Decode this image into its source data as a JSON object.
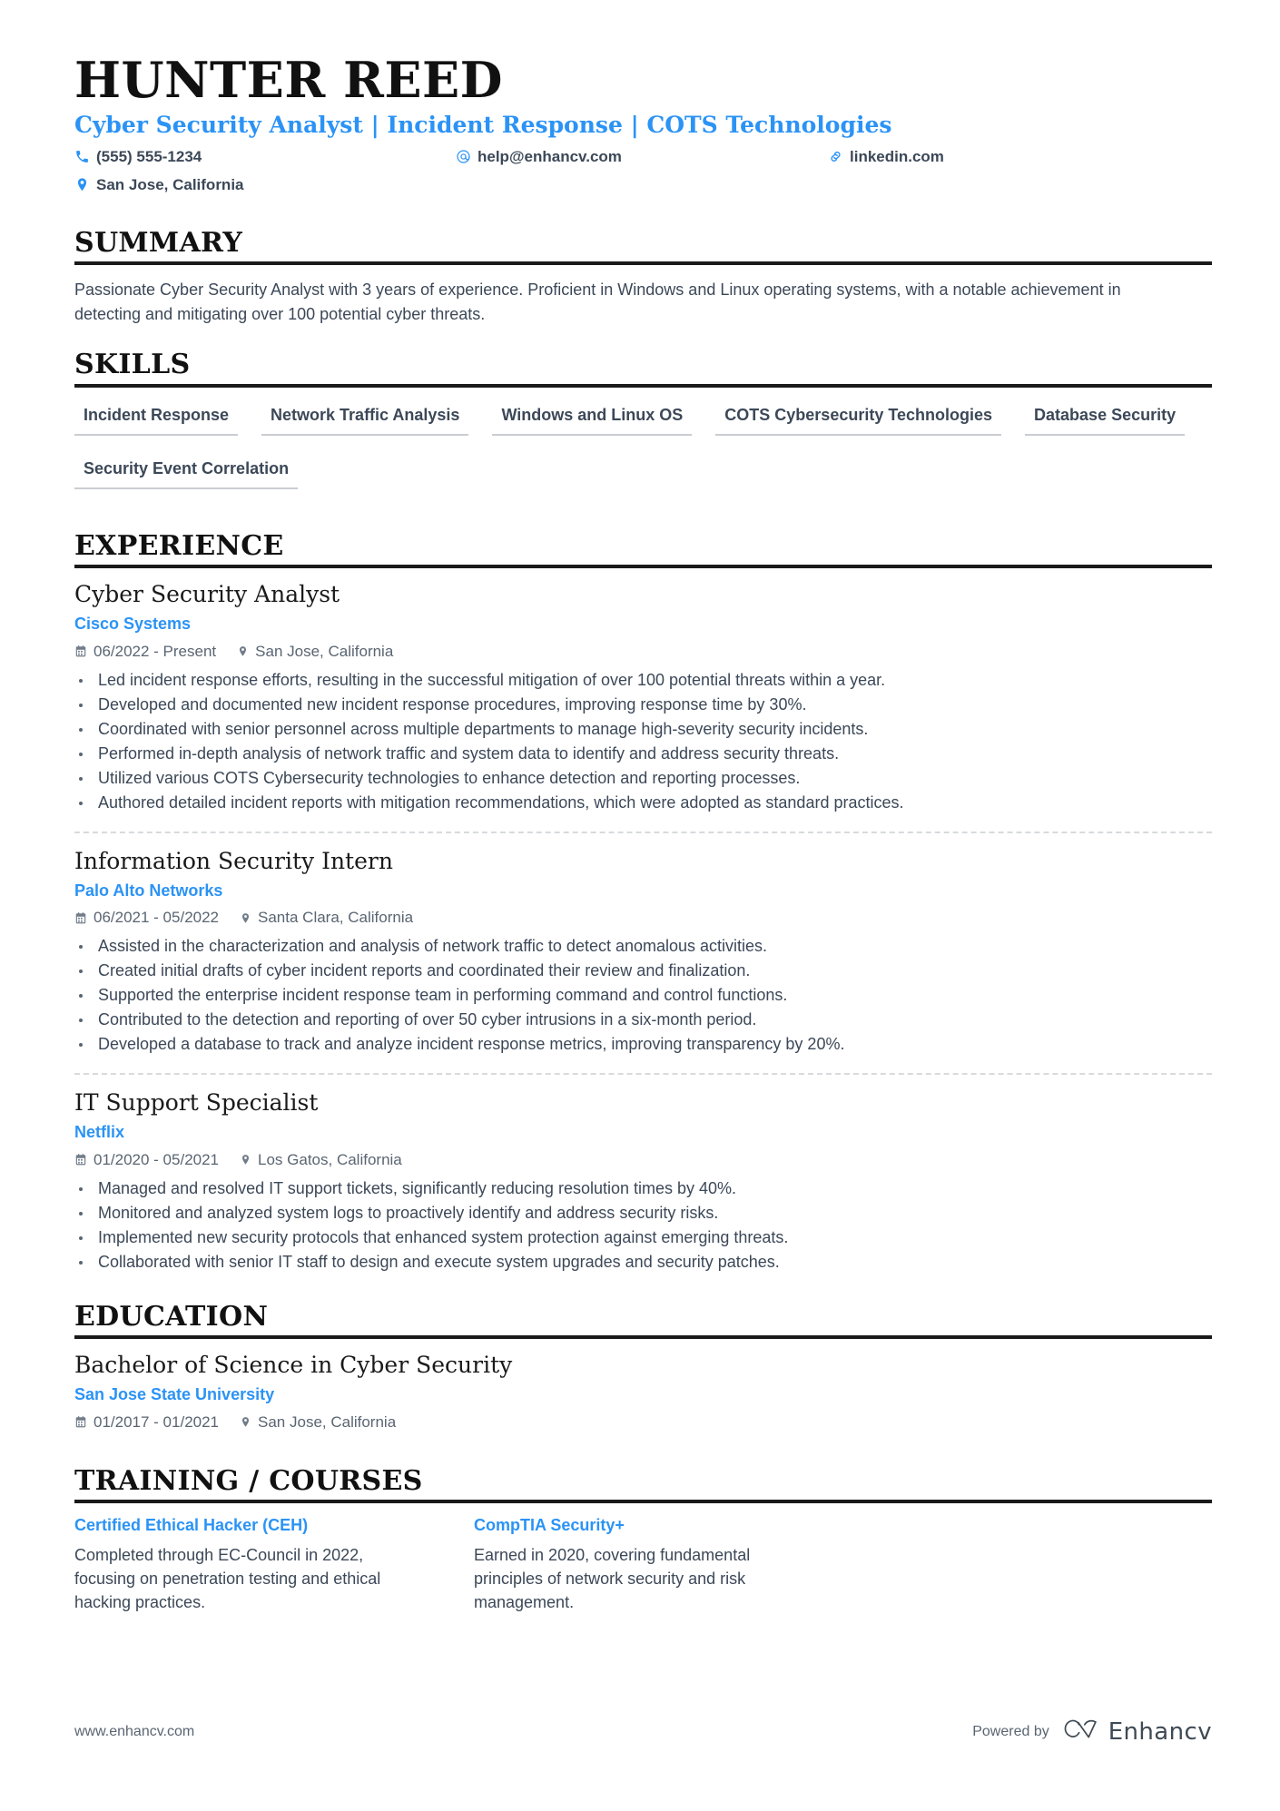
{
  "header": {
    "name": "HUNTER REED",
    "headline": "Cyber Security Analyst | Incident Response | COTS Technologies",
    "contacts": [
      {
        "icon": "phone-icon",
        "text": "(555) 555-1234"
      },
      {
        "icon": "email-icon",
        "text": "help@enhancv.com"
      },
      {
        "icon": "link-icon",
        "text": "linkedin.com"
      },
      {
        "icon": "location-pin-icon",
        "text": "San Jose, California"
      }
    ]
  },
  "colors": {
    "accent_blue": "#2b93f5",
    "text_dark": "#3c4858",
    "rule_black": "#1a1a1a",
    "skill_underline": "#c9ccd1",
    "divider_dashed": "#d8dadd"
  },
  "summary": {
    "title": "SUMMARY",
    "text": "Passionate Cyber Security Analyst with 3 years of experience. Proficient in Windows and Linux operating systems, with a notable achievement in detecting and mitigating over 100 potential cyber threats."
  },
  "skills": {
    "title": "SKILLS",
    "items": [
      "Incident Response",
      "Network Traffic Analysis",
      "Windows and Linux OS",
      "COTS Cybersecurity Technologies",
      "Database Security",
      "Security Event Correlation"
    ]
  },
  "experience": {
    "title": "EXPERIENCE",
    "entries": [
      {
        "job_title": "Cyber Security Analyst",
        "company": "Cisco Systems",
        "dates": "06/2022 - Present",
        "location": "San Jose, California",
        "bullets": [
          "Led incident response efforts, resulting in the successful mitigation of over 100 potential threats within a year.",
          "Developed and documented new incident response procedures, improving response time by 30%.",
          "Coordinated with senior personnel across multiple departments to manage high-severity security incidents.",
          "Performed in-depth analysis of network traffic and system data to identify and address security threats.",
          "Utilized various COTS Cybersecurity technologies to enhance detection and reporting processes.",
          "Authored detailed incident reports with mitigation recommendations, which were adopted as standard practices."
        ]
      },
      {
        "job_title": "Information Security Intern",
        "company": "Palo Alto Networks",
        "dates": "06/2021 - 05/2022",
        "location": "Santa Clara, California",
        "bullets": [
          "Assisted in the characterization and analysis of network traffic to detect anomalous activities.",
          "Created initial drafts of cyber incident reports and coordinated their review and finalization.",
          "Supported the enterprise incident response team in performing command and control functions.",
          "Contributed to the detection and reporting of over 50 cyber intrusions in a six-month period.",
          "Developed a database to track and analyze incident response metrics, improving transparency by 20%."
        ]
      },
      {
        "job_title": "IT Support Specialist",
        "company": "Netflix",
        "dates": "01/2020 - 05/2021",
        "location": "Los Gatos, California",
        "bullets": [
          "Managed and resolved IT support tickets, significantly reducing resolution times by 40%.",
          "Monitored and analyzed system logs to proactively identify and address security risks.",
          "Implemented new security protocols that enhanced system protection against emerging threats.",
          "Collaborated with senior IT staff to design and execute system upgrades and security patches."
        ]
      }
    ]
  },
  "education": {
    "title": "EDUCATION",
    "entries": [
      {
        "degree": "Bachelor of Science in Cyber Security",
        "school": "San Jose State University",
        "dates": "01/2017 - 01/2021",
        "location": "San Jose, California"
      }
    ]
  },
  "training": {
    "title": "TRAINING / COURSES",
    "courses": [
      {
        "name": "Certified Ethical Hacker (CEH)",
        "description": "Completed through EC-Council in 2022, focusing on penetration testing and ethical hacking practices."
      },
      {
        "name": "CompTIA Security+",
        "description": "Earned in 2020, covering fundamental principles of network security and risk management."
      }
    ]
  },
  "footer": {
    "url": "www.enhancv.com",
    "powered_by_label": "Powered by",
    "brand_name": "Enhancv",
    "brand_mark_icon": "enhancv-cv-logo-icon"
  }
}
